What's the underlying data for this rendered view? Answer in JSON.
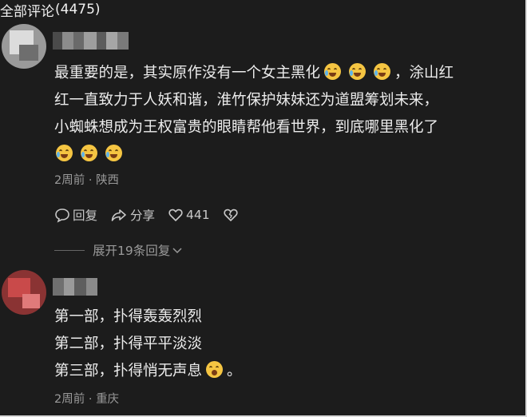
{
  "header": {
    "title": "全部评论",
    "count": "(4475)"
  },
  "comments": [
    {
      "username_redacted": true,
      "lines": [
        {
          "text": "最重要的是，其实原作没有一个女主黑化",
          "emojis": 3,
          "after": "，涂山红"
        },
        {
          "text": "红一直致力于人妖和谐，淮竹保护妹妹还为道盟筹划未来，",
          "emojis": 0,
          "after": ""
        },
        {
          "text": "小蜘蛛想成为王权富贵的眼睛帮他看世界，到底哪里黑化了",
          "emojis": 0,
          "after": ""
        },
        {
          "text": "",
          "emojis": 3,
          "after": ""
        }
      ],
      "time": "2周前",
      "location": "陕西",
      "actions": {
        "reply": "回复",
        "share": "分享",
        "likes": "441"
      },
      "expand_label": "展开19条回复"
    },
    {
      "username_redacted": true,
      "lines": [
        {
          "text": "第一部，扑得轰轰烈烈",
          "emojis": 0,
          "after": ""
        },
        {
          "text": "第二部，扑得平平淡淡",
          "emojis": 0,
          "after": ""
        },
        {
          "text": "第三部，扑得悄无声息",
          "emojis": 1,
          "after": "。"
        }
      ],
      "time": "2周前",
      "location": "重庆"
    }
  ],
  "icons": {
    "reply": "comment-bubble-icon",
    "share": "share-arrow-icon",
    "like": "heart-icon",
    "dislike": "broken-heart-icon",
    "expand": "chevron-down-icon",
    "emoji_laugh": "laugh-crying-emoji",
    "emoji_shock": "shocked-emoji"
  },
  "colors": {
    "background": "#1c1c1c",
    "text": "#ececec",
    "meta": "#9a9a9a",
    "emoji": "#f5c542"
  }
}
